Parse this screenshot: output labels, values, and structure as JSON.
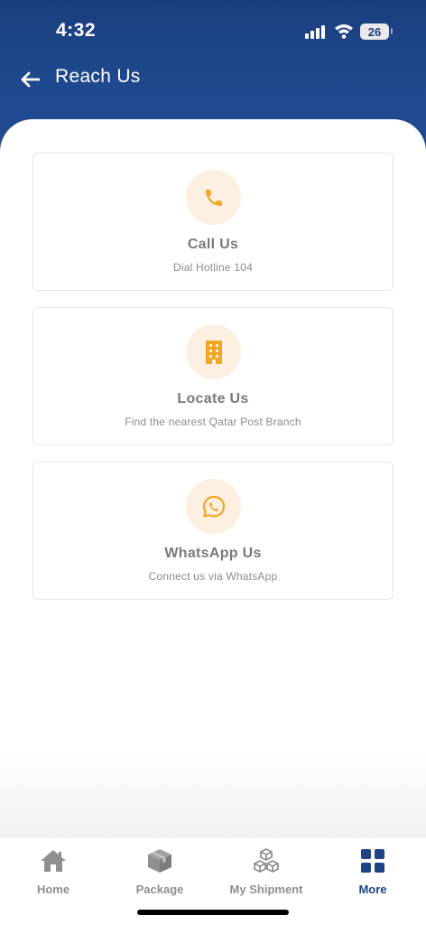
{
  "status": {
    "time": "4:32",
    "battery": "26"
  },
  "header": {
    "title": "Reach Us"
  },
  "cards": [
    {
      "title": "Call Us",
      "subtitle": "Dial Hotline 104",
      "icon": "phone-icon"
    },
    {
      "title": "Locate Us",
      "subtitle": "Find the nearest Qatar Post Branch",
      "icon": "building-icon"
    },
    {
      "title": "WhatsApp Us",
      "subtitle": "Connect us via WhatsApp",
      "icon": "whatsapp-icon"
    }
  ],
  "tabs": [
    {
      "label": "Home",
      "icon": "home-icon"
    },
    {
      "label": "Package",
      "icon": "package-icon"
    },
    {
      "label": "My Shipment",
      "icon": "boxes-icon"
    },
    {
      "label": "More",
      "icon": "grid-icon",
      "active": true
    }
  ],
  "colors": {
    "header_blue": "#1f4a91",
    "icon_orange": "#f2a623",
    "icon_bg": "#fdf0e3",
    "active_tab": "#1e4486"
  }
}
